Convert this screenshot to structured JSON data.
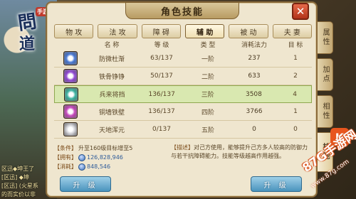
{
  "window": {
    "title": "角色技能",
    "close_label": "✕"
  },
  "game": {
    "logo_char1": "問",
    "logo_char2": "道",
    "logo_badge": "手游"
  },
  "chat": [
    "区迅◆坤王了",
    "[区迅]  ◆坤",
    "[区迅] (火星系",
    "的而实价以非"
  ],
  "tabs": [
    {
      "label": "物 攻",
      "active": false
    },
    {
      "label": "法 攻",
      "active": false
    },
    {
      "label": "障 碍",
      "active": false
    },
    {
      "label": "辅 助",
      "active": true
    },
    {
      "label": "被 动",
      "active": false
    },
    {
      "label": "夫 妻",
      "active": false
    }
  ],
  "table": {
    "headers": {
      "name": "名 称",
      "level": "等 级",
      "type": "类 型",
      "cost": "消耗法力",
      "target": "目 标"
    },
    "rows": [
      {
        "name": "防微杜渐",
        "level": "63/137",
        "type": "一阶",
        "cost": "237",
        "target": "1",
        "color": "#3b6fd1",
        "selected": false
      },
      {
        "name": "铁骨铮铮",
        "level": "50/137",
        "type": "二阶",
        "cost": "633",
        "target": "2",
        "color": "#8a3cd1",
        "selected": false
      },
      {
        "name": "兵来将挡",
        "level": "136/137",
        "type": "三阶",
        "cost": "3508",
        "target": "4",
        "color": "#2fae9a",
        "selected": true
      },
      {
        "name": "铜墙铁壁",
        "level": "136/137",
        "type": "四阶",
        "cost": "3766",
        "target": "1",
        "color": "#c23ab8",
        "selected": false
      },
      {
        "name": "天地浑元",
        "level": "0/137",
        "type": "五阶",
        "cost": "0",
        "target": "0",
        "color": "#cfcfd4",
        "selected": false
      }
    ]
  },
  "info": {
    "condition_tag": "【条件】",
    "condition": "升至160级目标增至5",
    "owned_tag": "【拥有】",
    "owned": "126,828,946",
    "consume_tag": "【消耗】",
    "consume": "848,546",
    "description_tag": "【描述】",
    "description": "对己方使用，能够提升己方多人较高的防御力与若干抗障碍能力。技能等级越高作用越强。"
  },
  "buttons": {
    "upgrade_left": "升 级",
    "upgrade_right": "升 级"
  },
  "side_tabs": [
    {
      "label": "属性",
      "active": false
    },
    {
      "label": "加点",
      "active": false
    },
    {
      "label": "相性",
      "active": false
    },
    {
      "label": "技能",
      "active": true
    }
  ],
  "watermark": {
    "logo": "K",
    "big": "87G手游网",
    "small": "www.87g.com"
  }
}
